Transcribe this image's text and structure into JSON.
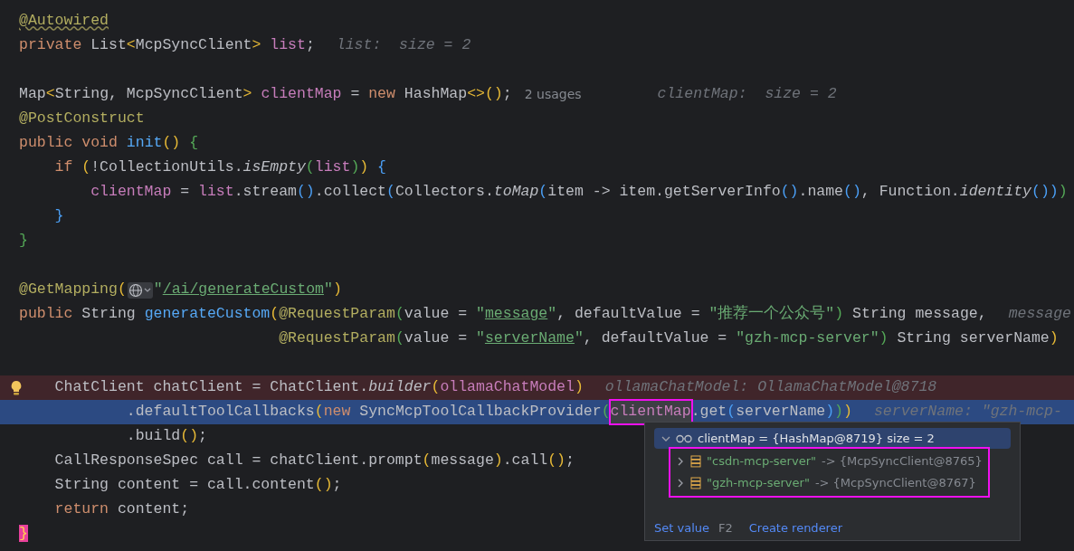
{
  "editor": {
    "lines": [
      {
        "kind": "code",
        "segments": [
          {
            "kind": "code",
            "tokens": [
              {
                "kind": "annotation_warn",
                "text": "@Autowired"
              }
            ]
          }
        ]
      },
      {
        "kind": "code",
        "segments": [
          {
            "kind": "code",
            "tokens": [
              {
                "kind": "keyword",
                "text": "private "
              },
              {
                "kind": "plain",
                "text": "List"
              },
              {
                "kind": "bracket1",
                "text": "<"
              },
              {
                "kind": "plain",
                "text": "McpSyncClient"
              },
              {
                "kind": "bracket1",
                "text": "> "
              },
              {
                "kind": "field",
                "text": "list"
              },
              {
                "kind": "plain",
                "text": ";"
              }
            ]
          },
          {
            "kind": "hint",
            "text": "list:  size = 2"
          }
        ]
      },
      {
        "kind": "blank"
      },
      {
        "kind": "code",
        "segments": [
          {
            "kind": "code",
            "tokens": [
              {
                "kind": "plain",
                "text": "Map"
              },
              {
                "kind": "bracket1",
                "text": "<"
              },
              {
                "kind": "plain",
                "text": "String, McpSyncClient"
              },
              {
                "kind": "bracket1",
                "text": "> "
              },
              {
                "kind": "field",
                "text": "clientMap"
              },
              {
                "kind": "plain",
                "text": " = "
              },
              {
                "kind": "keyword",
                "text": "new "
              },
              {
                "kind": "plain",
                "text": "HashMap"
              },
              {
                "kind": "bracket1",
                "text": "<>()"
              },
              {
                "kind": "plain",
                "text": ";"
              }
            ]
          },
          {
            "kind": "usages",
            "text": "2 usages"
          },
          {
            "kind": "hint",
            "text": "clientMap:  size = 2"
          }
        ]
      },
      {
        "kind": "code",
        "segments": [
          {
            "kind": "code",
            "tokens": [
              {
                "kind": "annotation",
                "text": "@PostConstruct"
              }
            ]
          }
        ]
      },
      {
        "kind": "code",
        "segments": [
          {
            "kind": "code",
            "tokens": [
              {
                "kind": "keyword",
                "text": "public void "
              },
              {
                "kind": "method",
                "text": "init"
              },
              {
                "kind": "bracket1",
                "text": "() "
              },
              {
                "kind": "bracket2",
                "text": "{"
              }
            ]
          }
        ]
      },
      {
        "kind": "code",
        "segments": [
          {
            "kind": "code",
            "tokens": [
              {
                "kind": "keyword",
                "text": "    if "
              },
              {
                "kind": "bracket1",
                "text": "("
              },
              {
                "kind": "plain",
                "text": "!CollectionUtils."
              },
              {
                "kind": "italic",
                "text": "isEmpty"
              },
              {
                "kind": "bracket2",
                "text": "("
              },
              {
                "kind": "field",
                "text": "list"
              },
              {
                "kind": "bracket2",
                "text": ")"
              },
              {
                "kind": "bracket1",
                "text": ") "
              },
              {
                "kind": "bracket3",
                "text": "{"
              }
            ]
          }
        ]
      },
      {
        "kind": "code",
        "segments": [
          {
            "kind": "code",
            "tokens": [
              {
                "kind": "field",
                "text": "        clientMap"
              },
              {
                "kind": "plain",
                "text": " = "
              },
              {
                "kind": "field",
                "text": "list"
              },
              {
                "kind": "plain",
                "text": ".stream"
              },
              {
                "kind": "bracket3",
                "text": "()"
              },
              {
                "kind": "plain",
                "text": ".collect"
              },
              {
                "kind": "bracket3",
                "text": "("
              },
              {
                "kind": "plain",
                "text": "Collectors."
              },
              {
                "kind": "italic",
                "text": "toMap"
              },
              {
                "kind": "bracket3",
                "text": "("
              },
              {
                "kind": "plain",
                "text": "item -> item.getServerInfo"
              },
              {
                "kind": "bracket3",
                "text": "()"
              },
              {
                "kind": "plain",
                "text": ".name"
              },
              {
                "kind": "bracket3",
                "text": "()"
              },
              {
                "kind": "plain",
                "text": ", Function."
              },
              {
                "kind": "italic",
                "text": "identity"
              },
              {
                "kind": "bracket3",
                "text": "())"
              },
              {
                "kind": "bracket2",
                "text": ")"
              }
            ]
          }
        ]
      },
      {
        "kind": "code",
        "segments": [
          {
            "kind": "code",
            "tokens": [
              {
                "kind": "bracket3",
                "text": "    }"
              }
            ]
          }
        ]
      },
      {
        "kind": "code",
        "segments": [
          {
            "kind": "code",
            "tokens": [
              {
                "kind": "bracket2",
                "text": "}"
              }
            ]
          }
        ]
      },
      {
        "kind": "blank"
      },
      {
        "kind": "code",
        "segments": [
          {
            "kind": "code",
            "tokens": [
              {
                "kind": "annotation",
                "text": "@GetMapping"
              },
              {
                "kind": "bracket1",
                "text": "("
              }
            ]
          },
          {
            "kind": "globe"
          },
          {
            "kind": "code",
            "tokens": [
              {
                "kind": "string",
                "text": "\""
              },
              {
                "kind": "link",
                "text": "/ai/generateCustom"
              },
              {
                "kind": "string",
                "text": "\""
              },
              {
                "kind": "bracket1",
                "text": ")"
              }
            ]
          }
        ]
      },
      {
        "kind": "code",
        "segments": [
          {
            "kind": "code",
            "tokens": [
              {
                "kind": "keyword",
                "text": "public "
              },
              {
                "kind": "plain",
                "text": "String "
              },
              {
                "kind": "method",
                "text": "generateCustom"
              },
              {
                "kind": "bracket1",
                "text": "("
              },
              {
                "kind": "annotation",
                "text": "@RequestParam"
              },
              {
                "kind": "bracket2",
                "text": "("
              },
              {
                "kind": "plain",
                "text": "value = "
              },
              {
                "kind": "string",
                "text": "\""
              },
              {
                "kind": "link",
                "text": "message"
              },
              {
                "kind": "string",
                "text": "\""
              },
              {
                "kind": "plain",
                "text": ", defaultValue = "
              },
              {
                "kind": "string",
                "text": "\"推荐一个公众号\""
              },
              {
                "kind": "bracket2",
                "text": ")"
              },
              {
                "kind": "plain",
                "text": " String message,"
              }
            ]
          },
          {
            "kind": "hint",
            "text": "message"
          }
        ]
      },
      {
        "kind": "code",
        "segments": [
          {
            "kind": "code",
            "tokens": [
              {
                "kind": "annotation",
                "text": "                             @RequestParam"
              },
              {
                "kind": "bracket2",
                "text": "("
              },
              {
                "kind": "plain",
                "text": "value = "
              },
              {
                "kind": "string",
                "text": "\""
              },
              {
                "kind": "link",
                "text": "serverName"
              },
              {
                "kind": "string",
                "text": "\""
              },
              {
                "kind": "plain",
                "text": ", defaultValue = "
              },
              {
                "kind": "string",
                "text": "\"gzh-mcp-server\""
              },
              {
                "kind": "bracket2",
                "text": ")"
              },
              {
                "kind": "plain",
                "text": " String serverName"
              },
              {
                "kind": "bracket1",
                "text": ")"
              }
            ]
          }
        ]
      },
      {
        "kind": "blank"
      },
      {
        "kind": "breakpoint",
        "bulb": true,
        "segments": [
          {
            "kind": "code",
            "tokens": [
              {
                "kind": "plain",
                "text": "    ChatClient chatClient = ChatClient."
              },
              {
                "kind": "italic",
                "text": "builder"
              },
              {
                "kind": "bracket1",
                "text": "("
              },
              {
                "kind": "field",
                "text": "ollamaChatModel"
              },
              {
                "kind": "bracket1",
                "text": ")"
              }
            ]
          },
          {
            "kind": "hint",
            "text": "ollamaChatModel: OllamaChatModel@8718"
          }
        ]
      },
      {
        "kind": "execution",
        "segments": [
          {
            "kind": "code",
            "tokens": [
              {
                "kind": "plain",
                "text": "            .defaultToolCallbacks"
              },
              {
                "kind": "bracket1",
                "text": "("
              },
              {
                "kind": "keyword",
                "text": "new "
              },
              {
                "kind": "plain",
                "text": "SyncMcpToolCallbackProvider"
              },
              {
                "kind": "bracket2",
                "text": "("
              }
            ]
          },
          {
            "kind": "boxed",
            "tokens": [
              {
                "kind": "field",
                "text": "clientMap"
              }
            ]
          },
          {
            "kind": "code",
            "tokens": [
              {
                "kind": "plain",
                "text": ".get"
              },
              {
                "kind": "bracket3",
                "text": "("
              },
              {
                "kind": "plain",
                "text": "serverName"
              },
              {
                "kind": "bracket3",
                "text": ")"
              },
              {
                "kind": "bracket2",
                "text": ")"
              },
              {
                "kind": "bracket1",
                "text": ")"
              }
            ]
          },
          {
            "kind": "hint",
            "text": "serverName: \"gzh-mcp-"
          }
        ]
      },
      {
        "kind": "code",
        "segments": [
          {
            "kind": "code",
            "tokens": [
              {
                "kind": "plain",
                "text": "            .build"
              },
              {
                "kind": "bracket1",
                "text": "()"
              },
              {
                "kind": "plain",
                "text": ";"
              }
            ]
          }
        ]
      },
      {
        "kind": "code",
        "segments": [
          {
            "kind": "code",
            "tokens": [
              {
                "kind": "plain",
                "text": "    CallResponseSpec call = chatClient.prompt"
              },
              {
                "kind": "bracket1",
                "text": "("
              },
              {
                "kind": "plain",
                "text": "message"
              },
              {
                "kind": "bracket1",
                "text": ")"
              },
              {
                "kind": "plain",
                "text": ".call"
              },
              {
                "kind": "bracket1",
                "text": "()"
              },
              {
                "kind": "plain",
                "text": ";"
              }
            ]
          }
        ]
      },
      {
        "kind": "code",
        "segments": [
          {
            "kind": "code",
            "tokens": [
              {
                "kind": "plain",
                "text": "    String content = call.content"
              },
              {
                "kind": "bracket1",
                "text": "()"
              },
              {
                "kind": "plain",
                "text": ";"
              }
            ]
          }
        ]
      },
      {
        "kind": "code",
        "segments": [
          {
            "kind": "code",
            "tokens": [
              {
                "kind": "keyword",
                "text": "    return "
              },
              {
                "kind": "plain",
                "text": "content;"
              }
            ]
          }
        ]
      },
      {
        "kind": "code",
        "segments": [
          {
            "kind": "code",
            "tokens": [
              {
                "kind": "match",
                "text": "}"
              }
            ]
          }
        ]
      }
    ]
  },
  "debug_popup": {
    "root": {
      "text": "clientMap = {HashMap@8719}  size = 2",
      "expanded": true,
      "selected": true,
      "children": [
        {
          "key": "\"csdn-mcp-server\"",
          "value": "-> {McpSyncClient@8765}",
          "expanded": false
        },
        {
          "key": "\"gzh-mcp-server\"",
          "value": "-> {McpSyncClient@8767}",
          "expanded": false
        }
      ],
      "children_boxed": true
    },
    "actions": [
      {
        "label": "Set value",
        "shortcut": "F2"
      },
      {
        "label": "Create renderer"
      }
    ]
  }
}
